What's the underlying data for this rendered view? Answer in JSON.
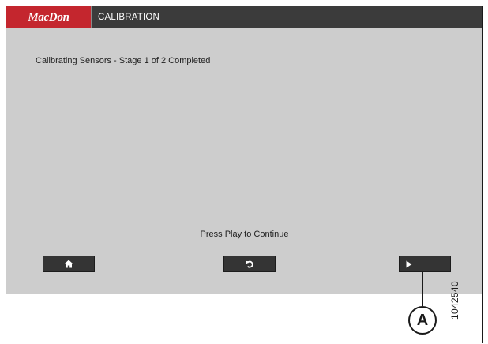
{
  "header": {
    "brand": "MacDon",
    "title": "CALIBRATION"
  },
  "main": {
    "status": "Calibrating Sensors - Stage 1 of 2 Completed",
    "prompt": "Press Play to Continue"
  },
  "buttons": [
    {
      "name": "home-button",
      "icon": "home-icon"
    },
    {
      "name": "back-button",
      "icon": "undo-arrow-icon"
    },
    {
      "name": "play-button",
      "icon": "play-icon"
    }
  ],
  "annotation": {
    "callout_label": "A",
    "figure_id": "1042540"
  },
  "colors": {
    "brand_red": "#c4262e",
    "header_bg": "#3b3b3b",
    "screen_bg": "#cdcdcd",
    "button_bg": "#343434"
  }
}
